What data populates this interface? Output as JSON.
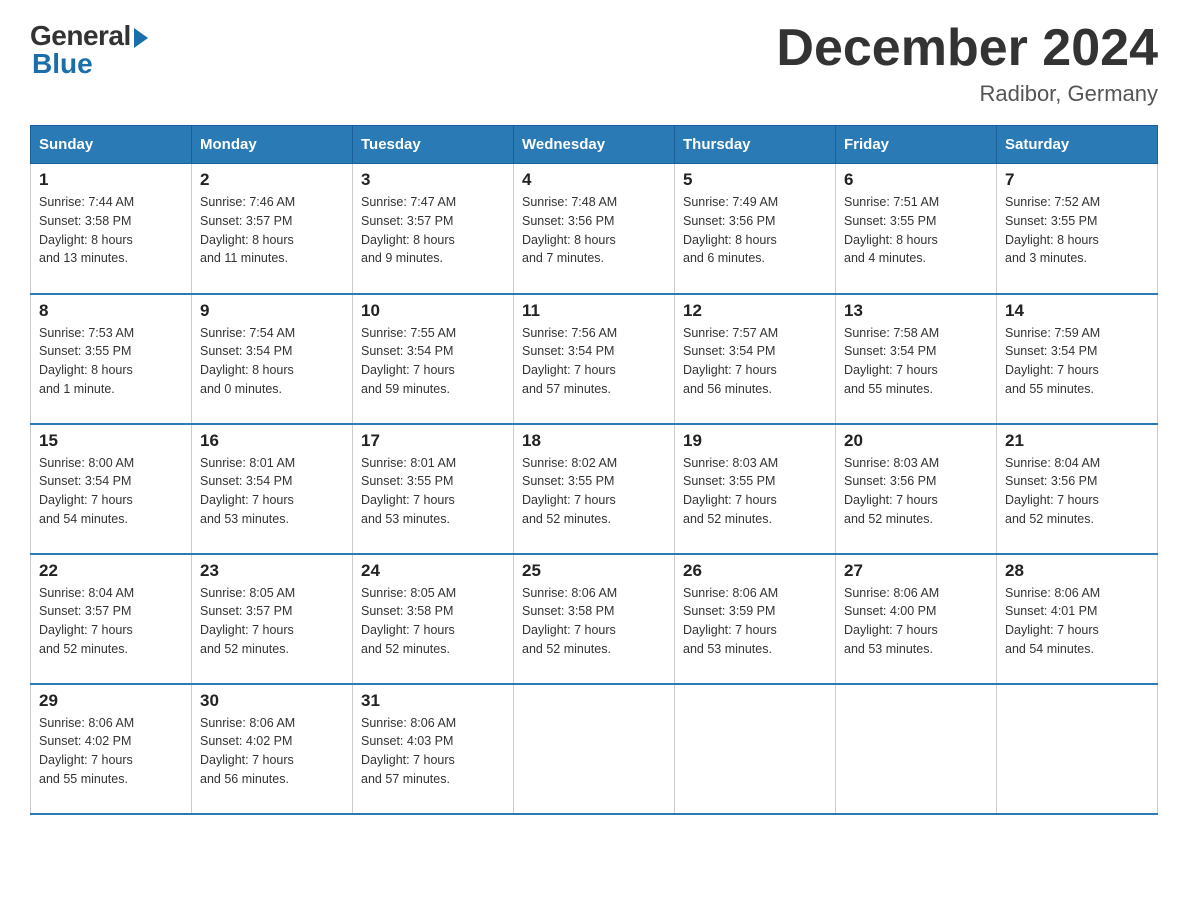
{
  "logo": {
    "general": "General",
    "blue": "Blue"
  },
  "title": {
    "month": "December 2024",
    "location": "Radibor, Germany"
  },
  "weekdays": [
    "Sunday",
    "Monday",
    "Tuesday",
    "Wednesday",
    "Thursday",
    "Friday",
    "Saturday"
  ],
  "weeks": [
    [
      {
        "day": "1",
        "info": "Sunrise: 7:44 AM\nSunset: 3:58 PM\nDaylight: 8 hours\nand 13 minutes."
      },
      {
        "day": "2",
        "info": "Sunrise: 7:46 AM\nSunset: 3:57 PM\nDaylight: 8 hours\nand 11 minutes."
      },
      {
        "day": "3",
        "info": "Sunrise: 7:47 AM\nSunset: 3:57 PM\nDaylight: 8 hours\nand 9 minutes."
      },
      {
        "day": "4",
        "info": "Sunrise: 7:48 AM\nSunset: 3:56 PM\nDaylight: 8 hours\nand 7 minutes."
      },
      {
        "day": "5",
        "info": "Sunrise: 7:49 AM\nSunset: 3:56 PM\nDaylight: 8 hours\nand 6 minutes."
      },
      {
        "day": "6",
        "info": "Sunrise: 7:51 AM\nSunset: 3:55 PM\nDaylight: 8 hours\nand 4 minutes."
      },
      {
        "day": "7",
        "info": "Sunrise: 7:52 AM\nSunset: 3:55 PM\nDaylight: 8 hours\nand 3 minutes."
      }
    ],
    [
      {
        "day": "8",
        "info": "Sunrise: 7:53 AM\nSunset: 3:55 PM\nDaylight: 8 hours\nand 1 minute."
      },
      {
        "day": "9",
        "info": "Sunrise: 7:54 AM\nSunset: 3:54 PM\nDaylight: 8 hours\nand 0 minutes."
      },
      {
        "day": "10",
        "info": "Sunrise: 7:55 AM\nSunset: 3:54 PM\nDaylight: 7 hours\nand 59 minutes."
      },
      {
        "day": "11",
        "info": "Sunrise: 7:56 AM\nSunset: 3:54 PM\nDaylight: 7 hours\nand 57 minutes."
      },
      {
        "day": "12",
        "info": "Sunrise: 7:57 AM\nSunset: 3:54 PM\nDaylight: 7 hours\nand 56 minutes."
      },
      {
        "day": "13",
        "info": "Sunrise: 7:58 AM\nSunset: 3:54 PM\nDaylight: 7 hours\nand 55 minutes."
      },
      {
        "day": "14",
        "info": "Sunrise: 7:59 AM\nSunset: 3:54 PM\nDaylight: 7 hours\nand 55 minutes."
      }
    ],
    [
      {
        "day": "15",
        "info": "Sunrise: 8:00 AM\nSunset: 3:54 PM\nDaylight: 7 hours\nand 54 minutes."
      },
      {
        "day": "16",
        "info": "Sunrise: 8:01 AM\nSunset: 3:54 PM\nDaylight: 7 hours\nand 53 minutes."
      },
      {
        "day": "17",
        "info": "Sunrise: 8:01 AM\nSunset: 3:55 PM\nDaylight: 7 hours\nand 53 minutes."
      },
      {
        "day": "18",
        "info": "Sunrise: 8:02 AM\nSunset: 3:55 PM\nDaylight: 7 hours\nand 52 minutes."
      },
      {
        "day": "19",
        "info": "Sunrise: 8:03 AM\nSunset: 3:55 PM\nDaylight: 7 hours\nand 52 minutes."
      },
      {
        "day": "20",
        "info": "Sunrise: 8:03 AM\nSunset: 3:56 PM\nDaylight: 7 hours\nand 52 minutes."
      },
      {
        "day": "21",
        "info": "Sunrise: 8:04 AM\nSunset: 3:56 PM\nDaylight: 7 hours\nand 52 minutes."
      }
    ],
    [
      {
        "day": "22",
        "info": "Sunrise: 8:04 AM\nSunset: 3:57 PM\nDaylight: 7 hours\nand 52 minutes."
      },
      {
        "day": "23",
        "info": "Sunrise: 8:05 AM\nSunset: 3:57 PM\nDaylight: 7 hours\nand 52 minutes."
      },
      {
        "day": "24",
        "info": "Sunrise: 8:05 AM\nSunset: 3:58 PM\nDaylight: 7 hours\nand 52 minutes."
      },
      {
        "day": "25",
        "info": "Sunrise: 8:06 AM\nSunset: 3:58 PM\nDaylight: 7 hours\nand 52 minutes."
      },
      {
        "day": "26",
        "info": "Sunrise: 8:06 AM\nSunset: 3:59 PM\nDaylight: 7 hours\nand 53 minutes."
      },
      {
        "day": "27",
        "info": "Sunrise: 8:06 AM\nSunset: 4:00 PM\nDaylight: 7 hours\nand 53 minutes."
      },
      {
        "day": "28",
        "info": "Sunrise: 8:06 AM\nSunset: 4:01 PM\nDaylight: 7 hours\nand 54 minutes."
      }
    ],
    [
      {
        "day": "29",
        "info": "Sunrise: 8:06 AM\nSunset: 4:02 PM\nDaylight: 7 hours\nand 55 minutes."
      },
      {
        "day": "30",
        "info": "Sunrise: 8:06 AM\nSunset: 4:02 PM\nDaylight: 7 hours\nand 56 minutes."
      },
      {
        "day": "31",
        "info": "Sunrise: 8:06 AM\nSunset: 4:03 PM\nDaylight: 7 hours\nand 57 minutes."
      },
      null,
      null,
      null,
      null
    ]
  ]
}
